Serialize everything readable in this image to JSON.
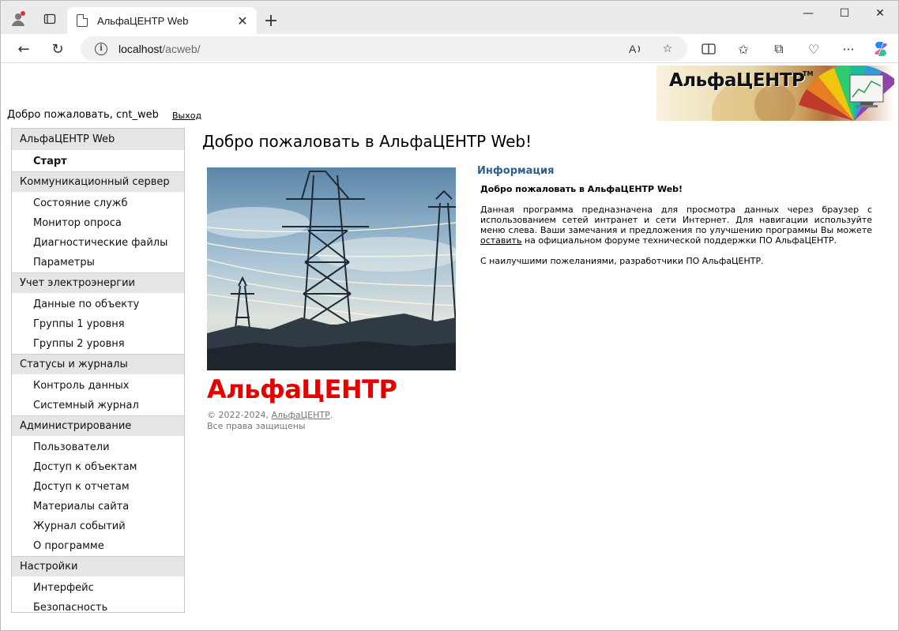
{
  "browser": {
    "tab_title": "АльфаЦЕНТР Web",
    "url_host": "localhost",
    "url_path": "/acweb/",
    "close_tab_glyph": "✕",
    "new_tab_glyph": "+",
    "minimize_glyph": "—",
    "maximize_glyph": "☐",
    "close_window_glyph": "✕",
    "back_glyph": "←",
    "refresh_glyph": "↻",
    "read_aloud_glyph": "Aᵃ",
    "favorite_glyph": "☆",
    "split_glyph": "◫",
    "favorites_glyph": "✩",
    "collections_glyph": "⧉",
    "health_glyph": "♡",
    "more_glyph": "···"
  },
  "header": {
    "welcome_text": "Добро пожаловать, cnt_web",
    "logout_label": "Выход",
    "logo_text": "АльфаЦЕНТР",
    "logo_tm": "TM"
  },
  "sidebar": {
    "sections": [
      {
        "title": "АльфаЦЕНТР Web",
        "items": [
          {
            "label": "Старт",
            "active": true
          }
        ]
      },
      {
        "title": "Коммуникационный сервер",
        "items": [
          {
            "label": "Состояние служб"
          },
          {
            "label": "Монитор опроса"
          },
          {
            "label": "Диагностические файлы"
          },
          {
            "label": "Параметры"
          }
        ]
      },
      {
        "title": "Учет электроэнергии",
        "items": [
          {
            "label": "Данные по объекту"
          },
          {
            "label": "Группы 1 уровня"
          },
          {
            "label": "Группы 2 уровня"
          }
        ]
      },
      {
        "title": "Статусы и журналы",
        "items": [
          {
            "label": "Контроль данных"
          },
          {
            "label": "Системный журнал"
          }
        ]
      },
      {
        "title": "Администрирование",
        "items": [
          {
            "label": "Пользователи"
          },
          {
            "label": "Доступ к объектам"
          },
          {
            "label": "Доступ к отчетам"
          },
          {
            "label": "Материалы сайта"
          },
          {
            "label": "Журнал событий"
          },
          {
            "label": "О программе"
          }
        ]
      },
      {
        "title": "Настройки",
        "items": [
          {
            "label": "Интерфейс"
          },
          {
            "label": "Безопасность"
          }
        ]
      }
    ]
  },
  "main": {
    "title": "Добро пожаловать в АльфаЦЕНТР Web!",
    "brand_big": "АльфаЦЕНТР",
    "copyright_prefix": "© 2022-2024, ",
    "copyright_link": "АльфаЦЕНТР",
    "copyright_suffix": ".",
    "rights": "Все права защищены",
    "info_title": "Информация",
    "info_welcome": "Добро пожаловать в АльфаЦЕНТР Web!",
    "info_para1_before": "Данная программа предназначена для просмотра данных через браузер с использованием сетей интранет и сети Интернет. Для навигации используйте меню слева. Ваши замечания и предложения по улучшению программы Вы можете ",
    "info_para1_link": "оставить",
    "info_para1_after": " на официальном форуме технической поддержки ПО АльфаЦЕНТР.",
    "info_para2": "С наилучшими пожеланиями, разработчики ПО АльфаЦЕНТР."
  },
  "colors": {
    "brand_red": "#e60000",
    "info_title_blue": "#2f5f8f",
    "sidebar_header_bg": "#e5e5e5"
  }
}
